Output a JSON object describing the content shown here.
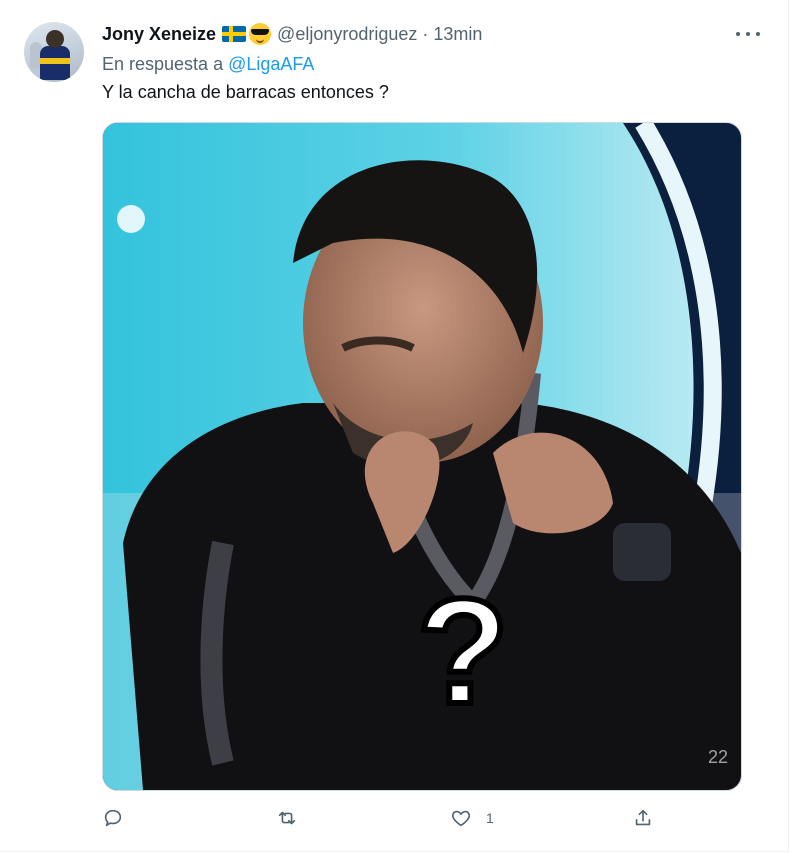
{
  "tweet": {
    "author_name": "Jony Xeneize",
    "handle": "@eljonyrodriguez",
    "separator": "·",
    "time": "13min",
    "reply_prefix": "En respuesta a",
    "reply_mention": "@LigaAFA",
    "text": "Y la cancha de barracas entonces ?",
    "media": {
      "overlay_text": "?",
      "watermark": "22"
    },
    "actions": {
      "reply_count": "",
      "retweet_count": "",
      "like_count": "1"
    }
  },
  "colors": {
    "accent": "#1d9bf0",
    "secondary_text": "#536471",
    "primary_text": "#0f1419"
  },
  "icons": [
    "avatar",
    "sweden-flag-emoji",
    "sunglasses-emoji",
    "more-icon",
    "reply-icon",
    "retweet-icon",
    "like-icon",
    "share-icon"
  ]
}
